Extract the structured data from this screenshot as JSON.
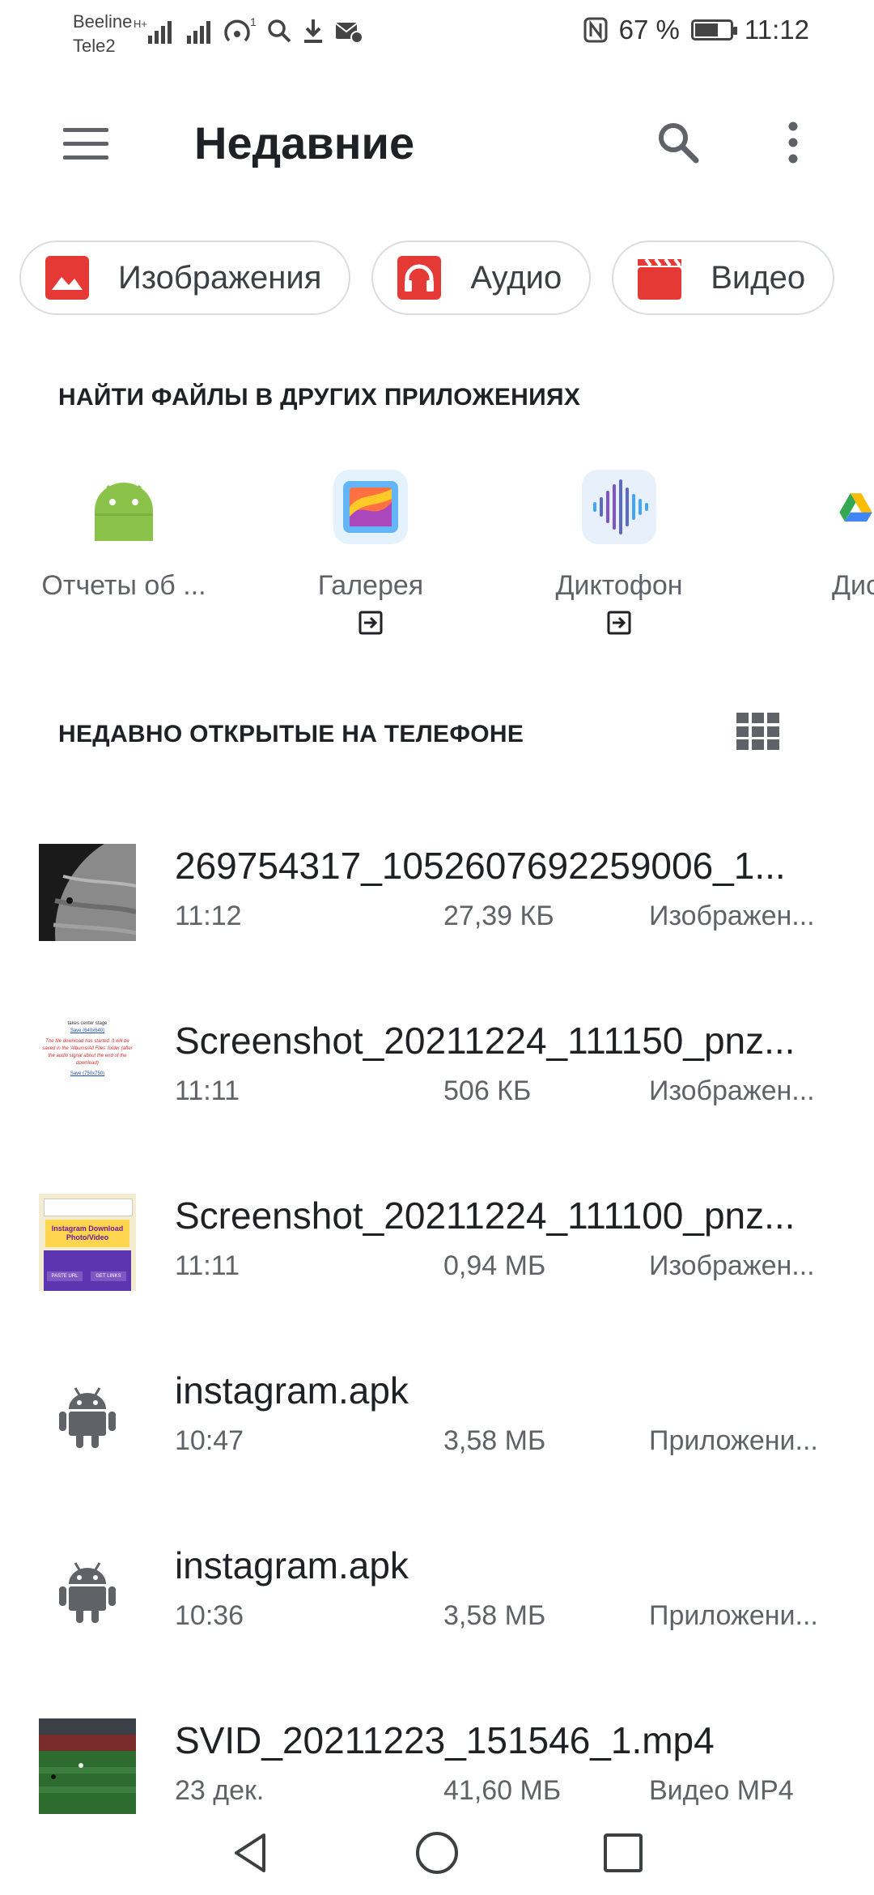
{
  "status_bar": {
    "carrier_1": "Beeline",
    "carrier_2": "Tele2",
    "battery_text": "67 %",
    "battery_level": 0.67,
    "time": "11:12"
  },
  "app_bar": {
    "title": "Недавние"
  },
  "chips": [
    {
      "label": "Изображения",
      "icon": "image-icon",
      "color": "#e53935"
    },
    {
      "label": "Аудио",
      "icon": "headphones-icon",
      "color": "#e53935"
    },
    {
      "label": "Видео",
      "icon": "clapperboard-icon",
      "color": "#e53935"
    }
  ],
  "other_apps": {
    "title": "НАЙТИ ФАЙЛЫ В ДРУГИХ ПРИЛОЖЕНИЯХ",
    "items": [
      {
        "label": "Отчеты об ...",
        "icon": "android-icon"
      },
      {
        "label": "Галерея",
        "icon": "gallery-icon"
      },
      {
        "label": "Диктофон",
        "icon": "recorder-icon"
      },
      {
        "label": "Дис",
        "icon": "drive-icon"
      }
    ]
  },
  "recent": {
    "title": "НЕДАВНО ОТКРЫТЫЕ НА ТЕЛЕФОНЕ",
    "files": [
      {
        "name": "269754317_1052607692259006_1...",
        "time": "11:12",
        "size": "27,39 КБ",
        "type": "Изображен..."
      },
      {
        "name": "Screenshot_20211224_111150_pnz...",
        "time": "11:11",
        "size": "506 КБ",
        "type": "Изображен..."
      },
      {
        "name": "Screenshot_20211224_111100_pnz...",
        "time": "11:11",
        "size": "0,94 МБ",
        "type": "Изображен..."
      },
      {
        "name": "instagram.apk",
        "time": "10:47",
        "size": "3,58 МБ",
        "type": "Приложени..."
      },
      {
        "name": "instagram.apk",
        "time": "10:36",
        "size": "3,58 МБ",
        "type": "Приложени..."
      },
      {
        "name": "SVID_20211223_151546_1.mp4",
        "time": "23 дек.",
        "size": "41,60 МБ",
        "type": "Видео MP4"
      }
    ]
  },
  "thumb_texts": {
    "s1_line1": "takes center stage",
    "s1_link1": "Save (640x640)",
    "s1_msg": "The file download has started. It will be saved in the 'Albums/All Files' folder (after the audio signal about the end of the download)",
    "s1_link2": "Save (750x750)",
    "s2_banner": "Instagram Download Photo/Video",
    "s2_btn1": "PASTE URL",
    "s2_btn2": "GET LINKS"
  }
}
